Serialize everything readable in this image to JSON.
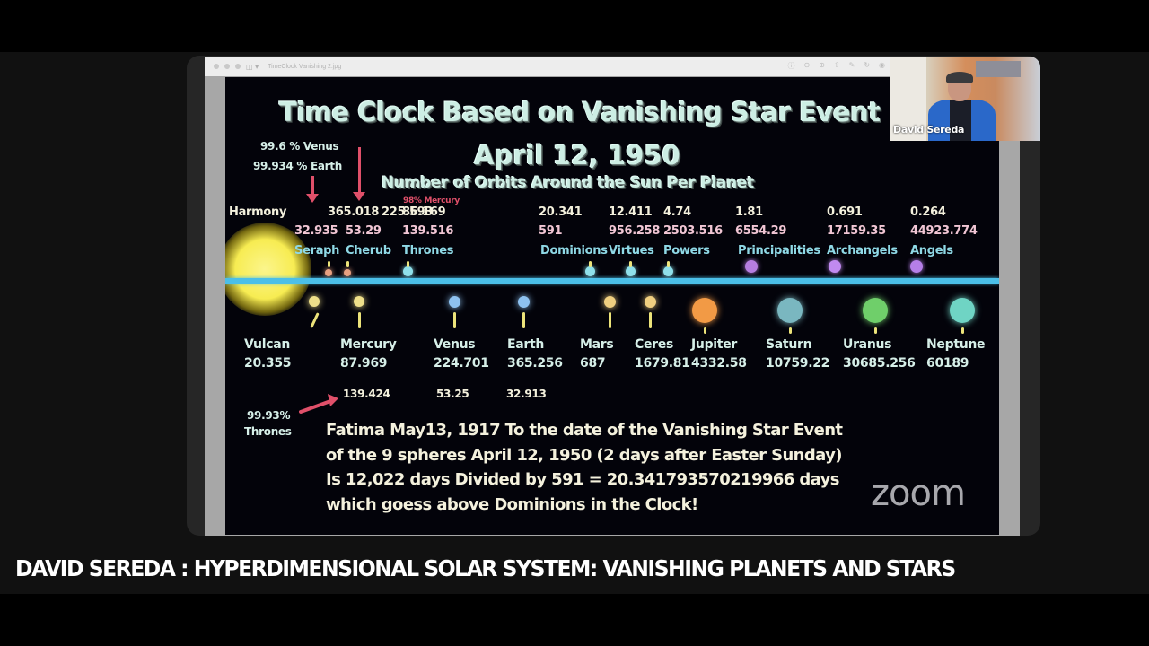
{
  "viewer": {
    "file_title": "TimeClock Vanishing 2.jpg",
    "toolbar_icons": [
      "info-icon",
      "zoom-out-icon",
      "zoom-in-icon",
      "share-icon",
      "markup-icon",
      "rotate-icon",
      "annotate-icon"
    ]
  },
  "slide": {
    "title_line1": "Time Clock Based on Vanishing Star Event",
    "title_line2": "April 12, 1950",
    "subtitle": "Number of Orbits Around the Sun Per Planet",
    "note_venus": "99.6 % Venus",
    "note_earth": "99.934 % Earth",
    "note_mercury": "98% Mercury",
    "harmony_label": "Harmony",
    "upper_spheres": [
      {
        "name": "Seraph",
        "orbits": "365.018",
        "period": "32.935",
        "color": "#e8a080"
      },
      {
        "name": "Cherub",
        "orbits": "225.593",
        "period": "53.29",
        "color": "#e8a080"
      },
      {
        "name": "Thrones",
        "orbits": "86.169",
        "period": "139.516",
        "color": "#8fe0ea"
      },
      {
        "name": "Dominions",
        "orbits": "20.341",
        "period": "591",
        "color": "#8fe0ea"
      },
      {
        "name": "Virtues",
        "orbits": "12.411",
        "period": "956.258",
        "color": "#8fe0ea"
      },
      {
        "name": "Powers",
        "orbits": "4.74",
        "period": "2503.516",
        "color": "#8fe0ea"
      },
      {
        "name": "Principalities",
        "orbits": "1.81",
        "period": "6554.29",
        "color": "#b67ee0"
      },
      {
        "name": "Archangels",
        "orbits": "0.691",
        "period": "17159.35",
        "color": "#c18af0"
      },
      {
        "name": "Angels",
        "orbits": "0.264",
        "period": "44923.774",
        "color": "#b57fe8"
      }
    ],
    "planets": [
      {
        "name": "Vulcan",
        "period": "20.355",
        "color": "#efe08a"
      },
      {
        "name": "Mercury",
        "period": "87.969",
        "color": "#efe08a"
      },
      {
        "name": "Venus",
        "period": "224.701",
        "color": "#8ec2f0"
      },
      {
        "name": "Earth",
        "period": "365.256",
        "color": "#8ec2f0"
      },
      {
        "name": "Mars",
        "period": "687",
        "color": "#f0cf80"
      },
      {
        "name": "Ceres",
        "period": "1679.81",
        "color": "#f0cf80"
      },
      {
        "name": "Jupiter",
        "period": "4332.58",
        "color": "#f29a45"
      },
      {
        "name": "Saturn",
        "period": "10759.22",
        "color": "#7ab7c0"
      },
      {
        "name": "Uranus",
        "period": "30685.256",
        "color": "#6fcf6a"
      },
      {
        "name": "Neptune",
        "period": "60189",
        "color": "#6fd4c4"
      }
    ],
    "extra_values": [
      "139.424",
      "53.25",
      "32.913"
    ],
    "thrones_note_pct": "99.93%",
    "thrones_note_label": "Thrones",
    "paragraph": [
      "Fatima May13, 1917  To the date of the Vanishing Star Event",
      "of the 9 spheres April 12, 1950 (2 days after Easter Sunday)",
      "Is 12,022 days Divided by 591 = 20.341793570219966 days",
      "which goess above Dominions in the Clock!"
    ]
  },
  "zoom_watermark": "zoom",
  "camera": {
    "participant_name": "David Sereda"
  },
  "caption": "DAVID SEREDA : HYPERDIMENSIONAL SOLAR SYSTEM: VANISHING PLANETS AND STARS"
}
